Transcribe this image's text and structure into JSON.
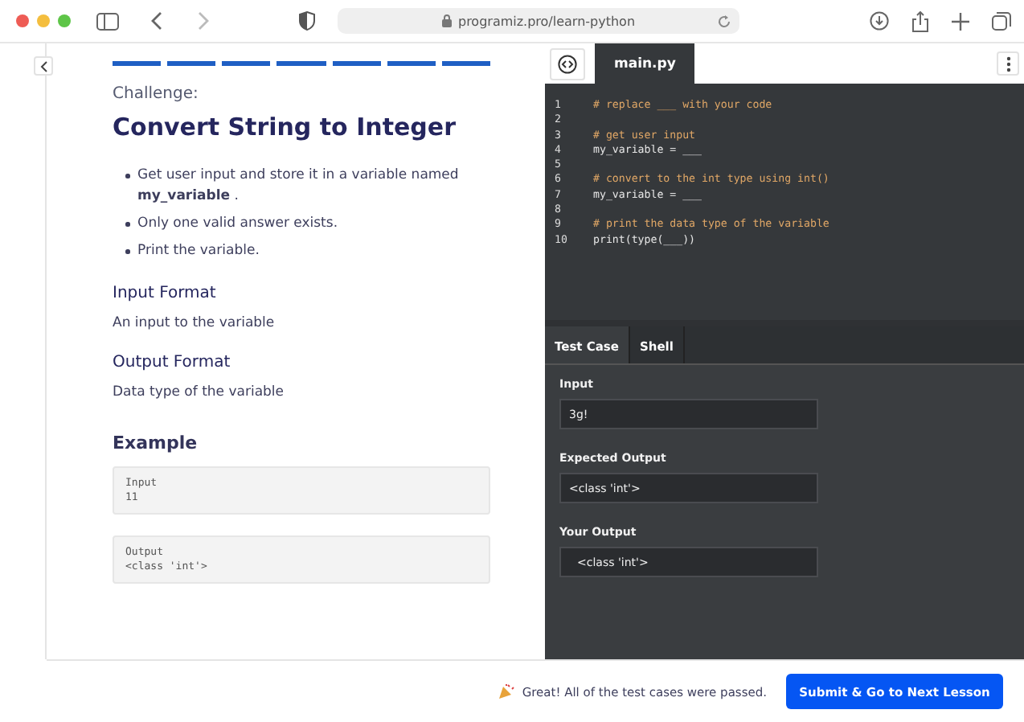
{
  "browser": {
    "url": "programiz.pro/learn-python"
  },
  "progress": [
    {
      "done": true
    },
    {
      "done": true
    },
    {
      "done": true
    },
    {
      "done": true
    },
    {
      "done": true
    },
    {
      "done": true
    },
    {
      "done": true
    }
  ],
  "challenge": {
    "label": "Challenge:",
    "title": "Convert String to Integer",
    "bullets": [
      "Get user input and store it in a variable named **my_variable** .",
      "Only one valid answer exists.",
      "Print the variable."
    ],
    "sections": [
      {
        "heading": "Input Format",
        "text": "An input to the variable"
      },
      {
        "heading": "Output Format",
        "text": "Data type of the variable"
      }
    ],
    "example": {
      "heading": "Example",
      "blocks": [
        {
          "label": "Input",
          "value": "11"
        },
        {
          "label": "Output",
          "value": "<class 'int'>"
        }
      ]
    }
  },
  "editor": {
    "tab": "main.py",
    "lines": [
      {
        "number": "1",
        "kind": "comment",
        "text": "# replace ___ with your code"
      },
      {
        "number": "2",
        "kind": "blank"
      },
      {
        "number": "3",
        "kind": "comment",
        "text": "# get user input"
      },
      {
        "number": "4",
        "kind": "code",
        "text": "my_variable = ___"
      },
      {
        "number": "5",
        "kind": "blank"
      },
      {
        "number": "6",
        "kind": "comment",
        "text": "# convert to the int type using int()"
      },
      {
        "number": "7",
        "kind": "code",
        "text": "my_variable = ___"
      },
      {
        "number": "8",
        "kind": "blank"
      },
      {
        "number": "9",
        "kind": "comment",
        "text": "# print the data type of the variable"
      },
      {
        "number": "10",
        "kind": "code",
        "text": "print(type(___))"
      }
    ]
  },
  "output_tabs": [
    {
      "label": "Test Case",
      "selected": true
    },
    {
      "label": "Shell",
      "selected": false
    }
  ],
  "test_case": [
    {
      "label": "Input",
      "value": "3g!"
    },
    {
      "label": "Expected Output",
      "value": "<class 'int'>"
    },
    {
      "label": "Your Output",
      "value": "<class 'int'>"
    }
  ],
  "footer": {
    "message": "Great! All of the test cases were passed.",
    "button": "Submit & Go to Next Lesson"
  }
}
